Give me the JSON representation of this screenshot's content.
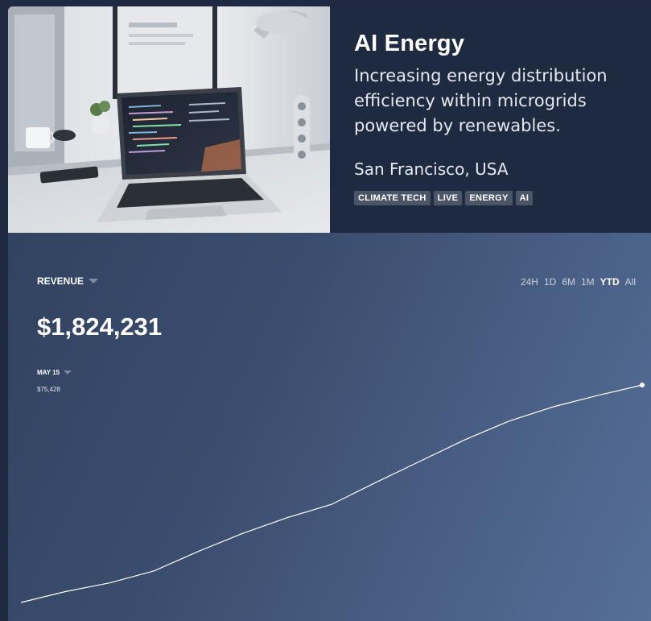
{
  "company": {
    "title": "AI Energy",
    "description": "Increasing energy distribution efficiency within microgrids powered by renewables.",
    "location": "San Francisco, USA",
    "tags": [
      "CLIMATE TECH",
      "LIVE",
      "ENERGY",
      "AI"
    ]
  },
  "metric": {
    "label": "REVENUE",
    "value": "$1,824,231",
    "ranges": [
      "24H",
      "1D",
      "6M",
      "1M",
      "YTD",
      "All"
    ],
    "active_range": "YTD"
  },
  "selection": {
    "date": "MAY 15",
    "value": "$75,428"
  },
  "colors": {
    "header_bg": "#1e2a40",
    "tag_bg": "#4a5568",
    "line": "#ffffff"
  },
  "chart_data": {
    "type": "line",
    "series": [
      {
        "values": [
          0.0,
          0.05,
          0.09,
          0.145,
          0.235,
          0.318,
          0.39,
          0.451,
          0.552,
          0.65,
          0.748,
          0.834,
          0.9,
          0.952,
          1.0
        ]
      }
    ],
    "grid": false,
    "legend": "none"
  }
}
